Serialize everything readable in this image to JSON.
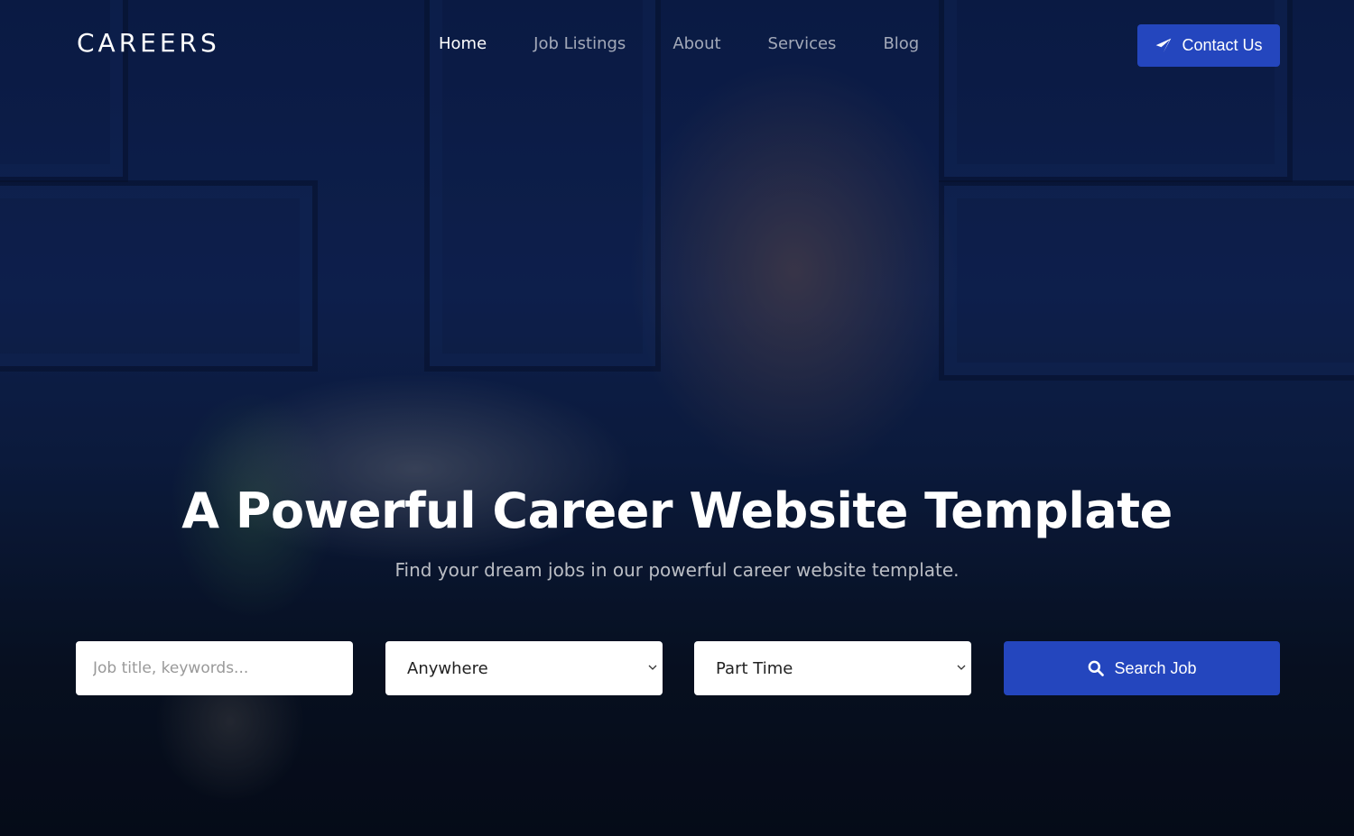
{
  "navbar": {
    "brand": "CAREERS",
    "links": [
      {
        "label": "Home",
        "active": true
      },
      {
        "label": "Job Listings",
        "active": false
      },
      {
        "label": "About",
        "active": false
      },
      {
        "label": "Services",
        "active": false
      },
      {
        "label": "Blog",
        "active": false
      }
    ],
    "contact_button": {
      "label": "Contact Us",
      "icon": "paper-plane-icon"
    }
  },
  "hero": {
    "title": "A Powerful Career Website Template",
    "subtitle": "Find your dream jobs in our powerful career website template."
  },
  "search": {
    "keyword_placeholder": "Job title, keywords...",
    "keyword_value": "",
    "location_selected": "Anywhere",
    "job_type_selected": "Part Time",
    "button_label": "Search Job",
    "button_icon": "search-icon"
  },
  "colors": {
    "accent": "#2446be",
    "overlay": "#0d1f4e"
  }
}
